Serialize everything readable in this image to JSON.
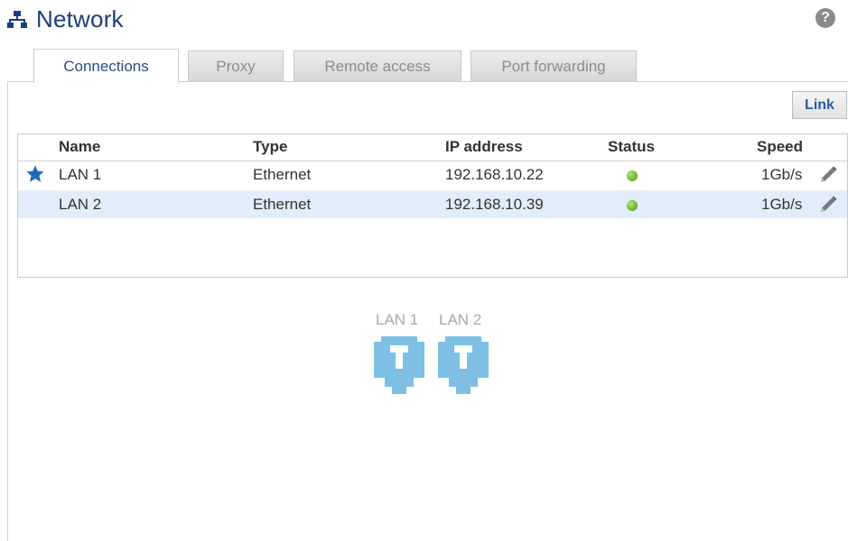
{
  "header": {
    "title": "Network",
    "icon": "network-icon",
    "help_icon": "?"
  },
  "tabs": [
    {
      "label": "Connections",
      "active": true
    },
    {
      "label": "Proxy",
      "active": false
    },
    {
      "label": "Remote access",
      "active": false
    },
    {
      "label": "Port forwarding",
      "active": false
    }
  ],
  "toolbar": {
    "link_label": "Link"
  },
  "table": {
    "columns": [
      "Name",
      "Type",
      "IP address",
      "Status",
      "Speed"
    ],
    "rows": [
      {
        "name": "LAN 1",
        "type": "Ethernet",
        "ip": "192.168.10.22",
        "status": "online",
        "speed": "1Gb/s",
        "primary": true
      },
      {
        "name": "LAN 2",
        "type": "Ethernet",
        "ip": "192.168.10.39",
        "status": "online",
        "speed": "1Gb/s",
        "primary": false
      }
    ]
  },
  "ports": [
    {
      "label": "LAN 1"
    },
    {
      "label": "LAN 2"
    }
  ],
  "colors": {
    "title": "#1a3d7c",
    "accent": "#1f5fa8",
    "row_highlight": "#e1eef9",
    "status_online": "#6fb535",
    "port_icon": "#7ec0e4"
  }
}
